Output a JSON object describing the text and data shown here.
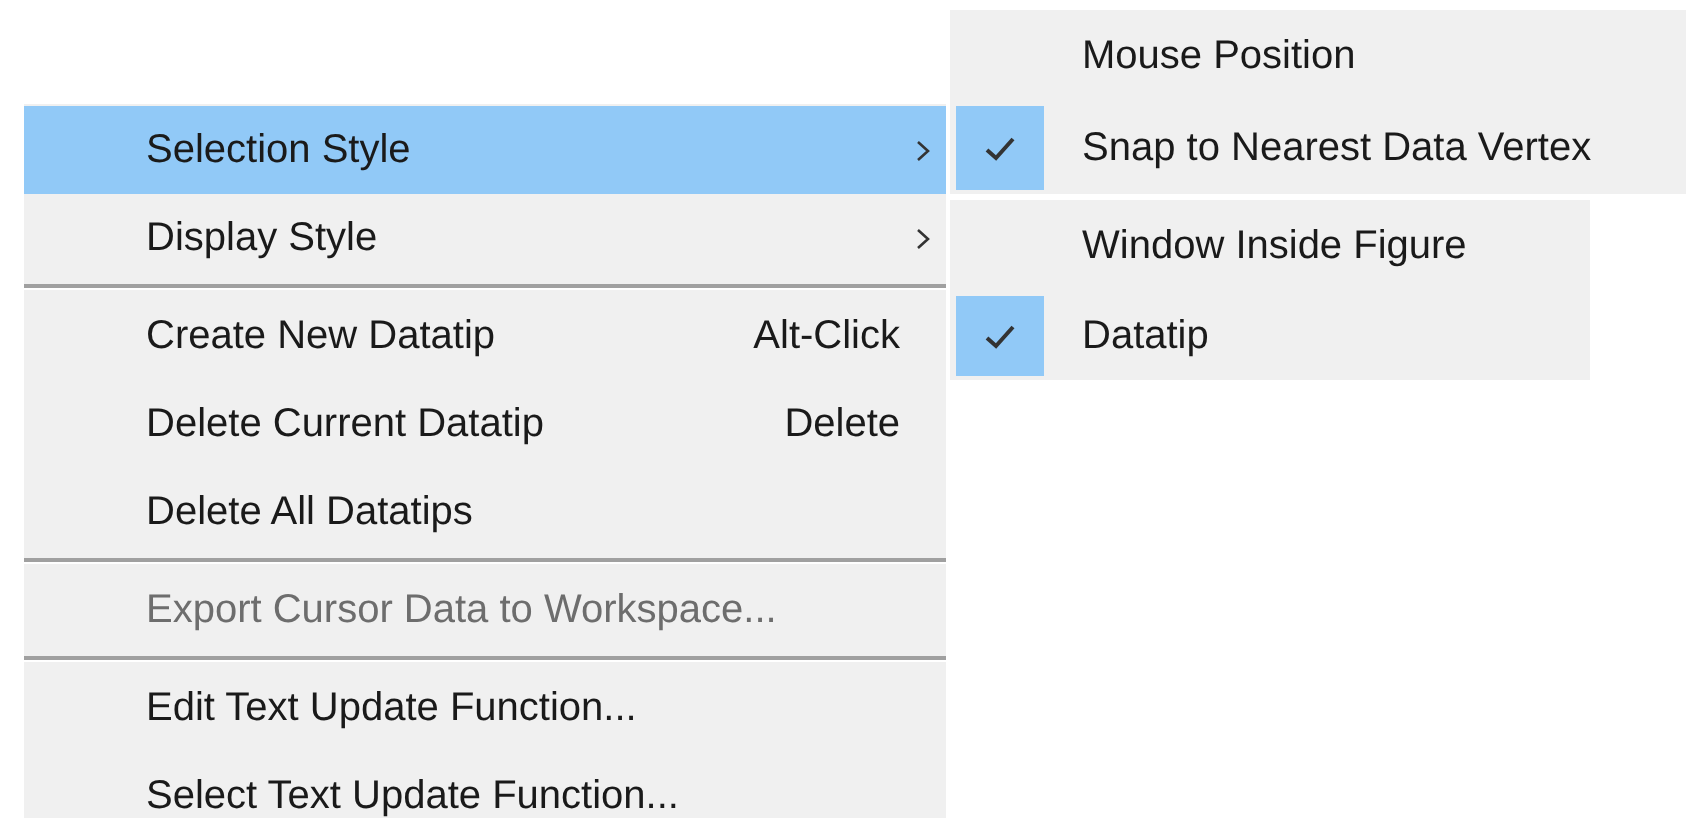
{
  "menu": {
    "items": [
      {
        "kind": "item",
        "label": "Selection Style",
        "submenu": true,
        "selected": true,
        "disabled": false
      },
      {
        "kind": "item",
        "label": "Display Style",
        "submenu": true,
        "selected": false,
        "disabled": false
      },
      {
        "kind": "separator"
      },
      {
        "kind": "item",
        "label": "Create New Datatip",
        "shortcut": "Alt-Click",
        "selected": false,
        "disabled": false
      },
      {
        "kind": "item",
        "label": "Delete Current Datatip",
        "shortcut": "Delete",
        "selected": false,
        "disabled": false
      },
      {
        "kind": "item",
        "label": "Delete All Datatips",
        "selected": false,
        "disabled": false
      },
      {
        "kind": "separator"
      },
      {
        "kind": "item",
        "label": "Export Cursor Data to Workspace...",
        "selected": false,
        "disabled": true
      },
      {
        "kind": "separator"
      },
      {
        "kind": "item",
        "label": "Edit Text Update Function...",
        "selected": false,
        "disabled": false
      },
      {
        "kind": "item",
        "label": "Select Text Update Function...",
        "selected": false,
        "disabled": false
      }
    ]
  },
  "submenus": [
    {
      "items": [
        {
          "label": "Mouse Position",
          "checked": false
        },
        {
          "label": "Snap to Nearest Data Vertex",
          "checked": true
        }
      ]
    },
    {
      "items": [
        {
          "label": "Window Inside Figure",
          "checked": false
        },
        {
          "label": "Datatip",
          "checked": true
        }
      ]
    }
  ]
}
